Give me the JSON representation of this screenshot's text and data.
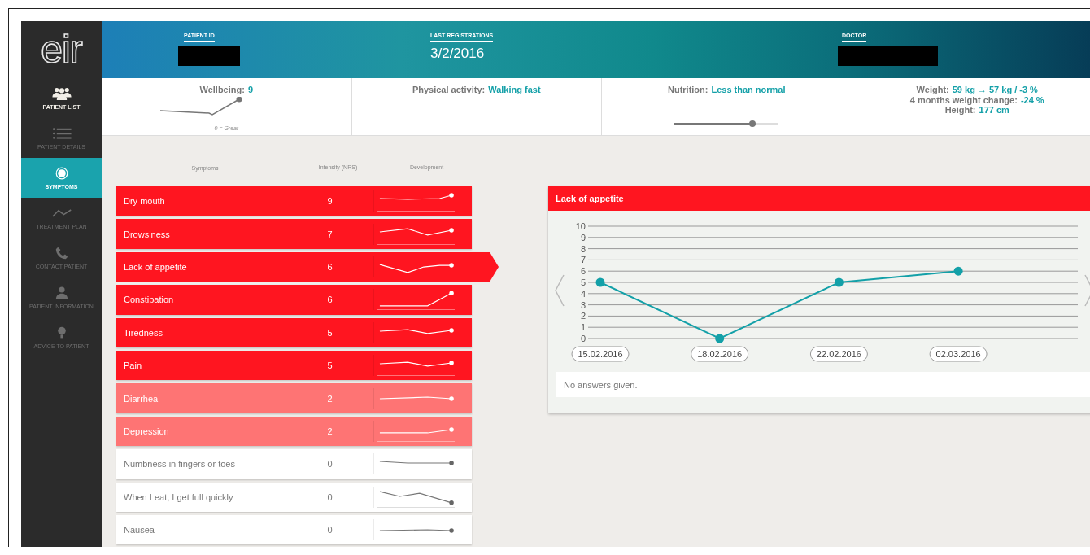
{
  "logo": "eir",
  "sidebar": {
    "items": [
      {
        "label": "PATIENT LIST",
        "kind": "people",
        "selected": false,
        "dimmed": false
      },
      {
        "label": "PATIENT DETAILS",
        "kind": "list",
        "selected": false,
        "dimmed": true
      },
      {
        "label": "SYMPTOMS",
        "kind": "ring",
        "selected": true,
        "dimmed": false
      },
      {
        "label": "TREATMENT PLAN",
        "kind": "zigzag",
        "selected": false,
        "dimmed": true
      },
      {
        "label": "CONTACT PATIENT",
        "kind": "phone",
        "selected": false,
        "dimmed": true
      },
      {
        "label": "PATIENT INFORMATION",
        "kind": "person",
        "selected": false,
        "dimmed": true
      },
      {
        "label": "ADVICE TO PATIENT",
        "kind": "bulb",
        "selected": false,
        "dimmed": true
      }
    ]
  },
  "header": {
    "fields": [
      {
        "label": "PATIENT ID",
        "kind": "redacted"
      },
      {
        "label": "LAST REGISTRATIONS",
        "kind": "text",
        "value": "3/2/2016"
      },
      {
        "label": "DOCTOR",
        "kind": "redacted"
      }
    ]
  },
  "stats": [
    {
      "kind": "wellbeing",
      "label": "Wellbeing:",
      "value": "9",
      "caption": "0 = Great"
    },
    {
      "kind": "plain",
      "label": "Physical activity:",
      "value": "Walking fast"
    },
    {
      "kind": "slider",
      "label": "Nutrition:",
      "value": "Less than normal",
      "level": 0.75
    },
    {
      "kind": "lines",
      "lines": [
        {
          "label": "Weight:",
          "value": "59 kg → 57 kg / -3 %"
        },
        {
          "label": "4 months weight change:",
          "value": "-24 %"
        },
        {
          "label": "Height:",
          "value": "177 cm"
        }
      ]
    }
  ],
  "symptoms": {
    "columns": [
      "Symptoms",
      "Intensity (NRS)",
      "Development"
    ],
    "rows": [
      {
        "name": "Dry mouth",
        "intensity": "9",
        "kind": "high",
        "selected": false
      },
      {
        "name": "Drowsiness",
        "intensity": "7",
        "kind": "high",
        "selected": false
      },
      {
        "name": "Lack of appetite",
        "intensity": "6",
        "kind": "high",
        "selected": true
      },
      {
        "name": "Constipation",
        "intensity": "6",
        "kind": "high",
        "selected": false
      },
      {
        "name": "Tiredness",
        "intensity": "5",
        "kind": "high",
        "selected": false
      },
      {
        "name": "Pain",
        "intensity": "5",
        "kind": "high",
        "selected": false
      },
      {
        "name": "Diarrhea",
        "intensity": "2",
        "kind": "medium",
        "selected": false
      },
      {
        "name": "Depression",
        "intensity": "2",
        "kind": "medium",
        "selected": false
      },
      {
        "name": "Numbness in fingers or toes",
        "intensity": "0",
        "kind": "none",
        "selected": false
      },
      {
        "name": "When I eat, I get full quickly",
        "intensity": "0",
        "kind": "none",
        "selected": false
      },
      {
        "name": "Nausea",
        "intensity": "0",
        "kind": "none",
        "selected": false
      }
    ]
  },
  "detail": {
    "title": "Lack of appetite",
    "chart_data": {
      "type": "line",
      "categories": [
        "15.02.2016",
        "18.02.2016",
        "22.02.2016",
        "02.03.2016"
      ],
      "series": [
        {
          "color": "#13a0a8",
          "marker": "circle",
          "values": [
            5,
            0,
            5,
            6
          ]
        }
      ],
      "grid": true,
      "ylim": [
        0,
        10
      ],
      "yticks": [
        0,
        1,
        2,
        3,
        4,
        5,
        6,
        7,
        8,
        9,
        10
      ]
    },
    "answers": "No answers given."
  }
}
